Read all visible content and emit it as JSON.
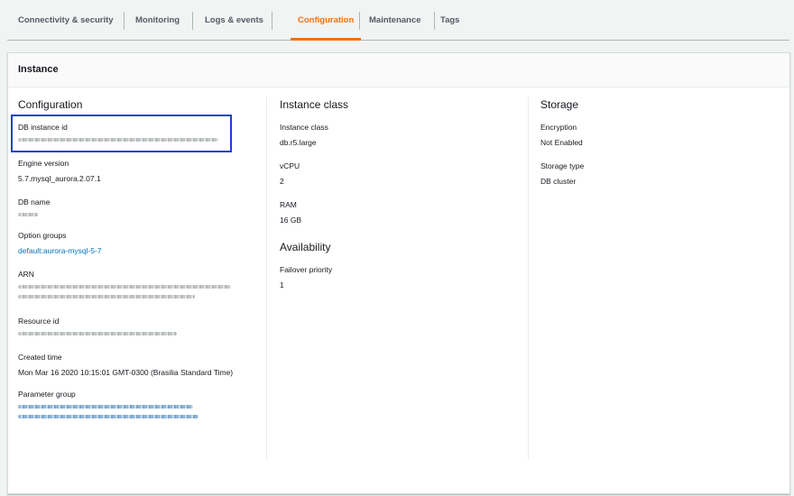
{
  "tabs": [
    {
      "label": "Connectivity & security"
    },
    {
      "label": "Monitoring"
    },
    {
      "label": "Logs & events"
    },
    {
      "label": "Configuration",
      "active": true
    },
    {
      "label": "Maintenance"
    },
    {
      "label": "Tags"
    }
  ],
  "panel": {
    "title": "Instance"
  },
  "configuration": {
    "title": "Configuration",
    "db_instance_id_label": "DB instance id",
    "engine_version_label": "Engine version",
    "engine_version": "5.7.mysql_aurora.2.07.1",
    "db_name_label": "DB name",
    "option_groups_label": "Option groups",
    "option_group": "default:aurora-mysql-5-7",
    "arn_label": "ARN",
    "resource_id_label": "Resource id",
    "created_time_label": "Created time",
    "created_time": "Mon Mar 16 2020 10:15:01 GMT-0300 (Brasilia Standard Time)",
    "parameter_group_label": "Parameter group"
  },
  "instance_class": {
    "title": "Instance class",
    "class_label": "Instance class",
    "class_value": "db.r5.large",
    "vcpu_label": "vCPU",
    "vcpu_value": "2",
    "ram_label": "RAM",
    "ram_value": "16 GB"
  },
  "availability": {
    "title": "Availability",
    "failover_label": "Failover priority",
    "failover_value": "1"
  },
  "storage": {
    "title": "Storage",
    "encryption_label": "Encryption",
    "encryption_value": "Not Enabled",
    "storage_type_label": "Storage type",
    "storage_type_value": "DB cluster"
  },
  "colors": {
    "accent": "#ec7211",
    "link": "#0073bb",
    "highlight": "#1c3fd8"
  }
}
